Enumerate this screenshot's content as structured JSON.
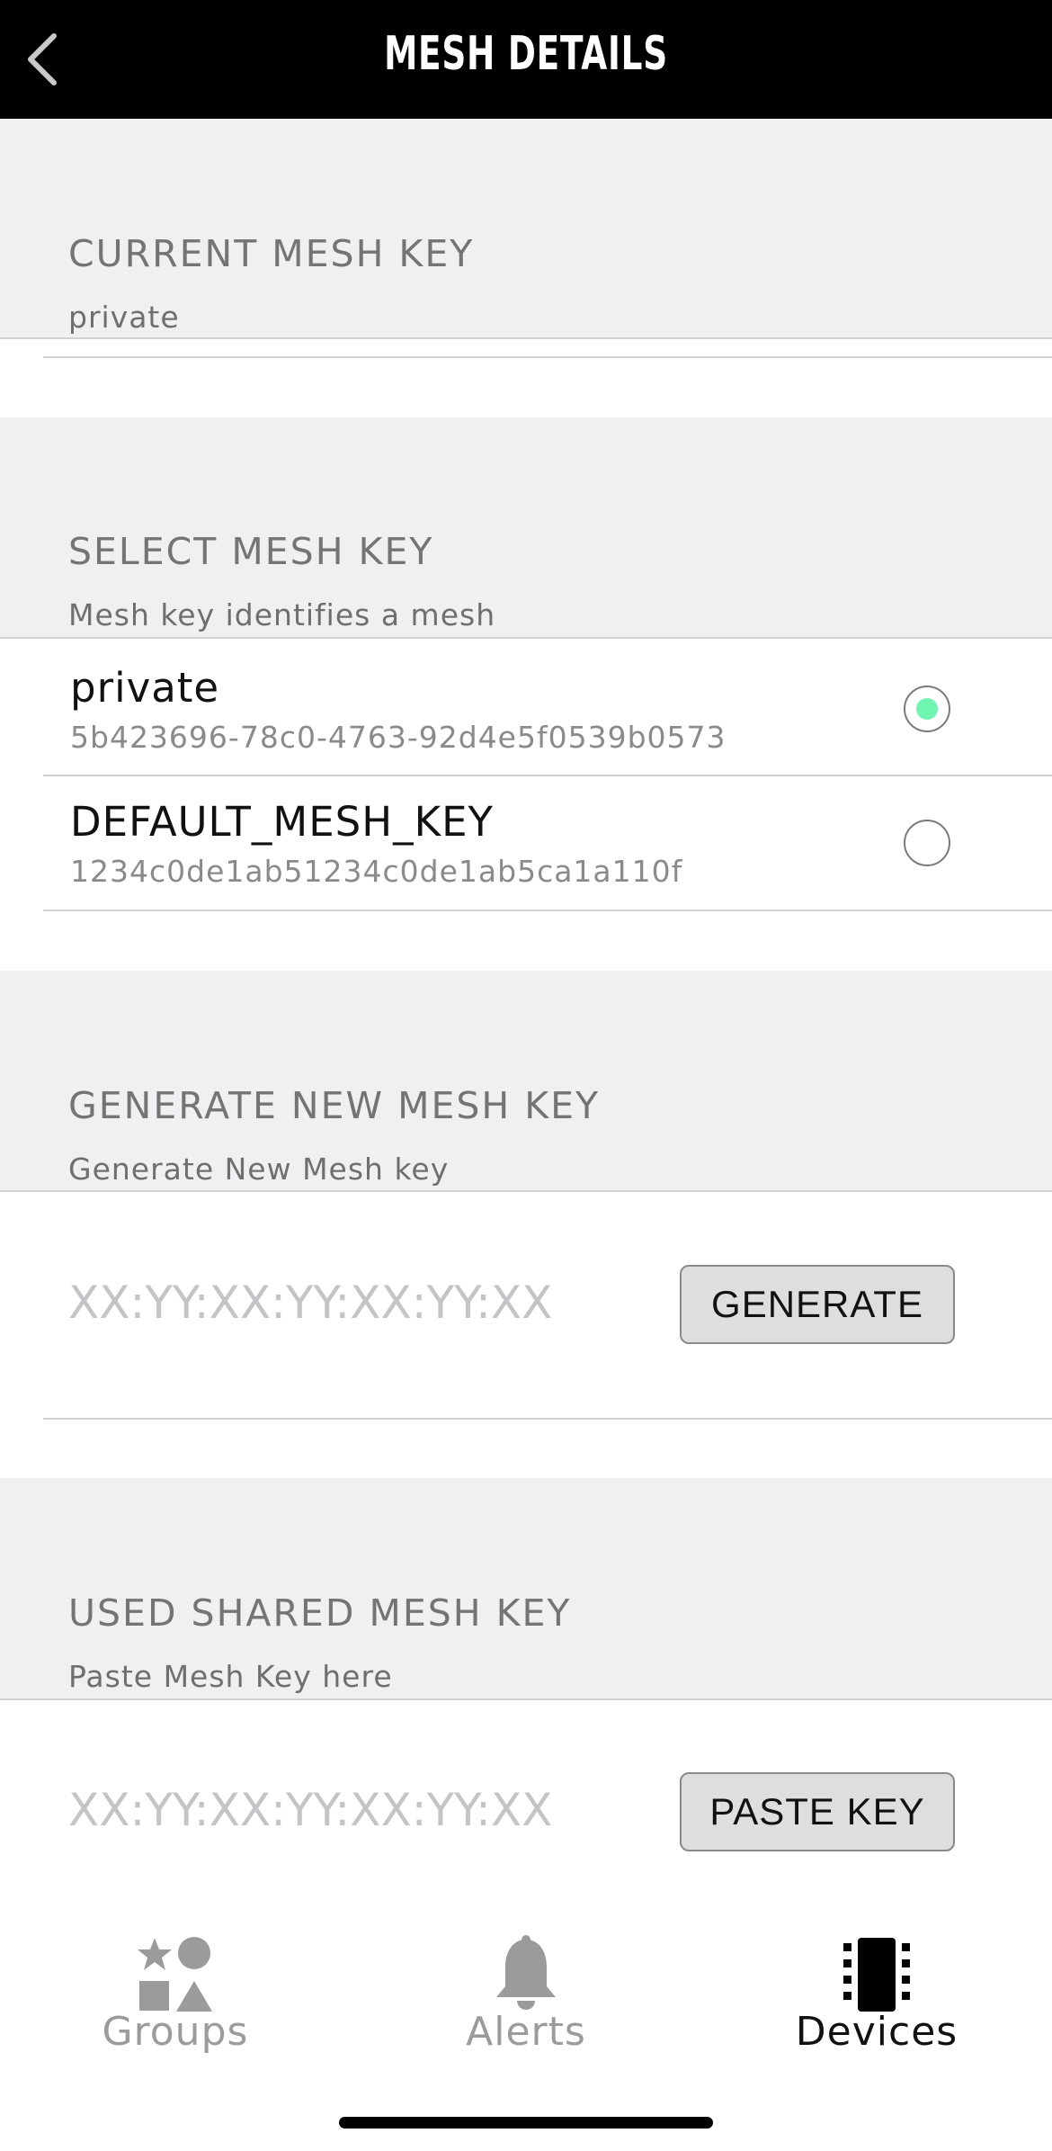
{
  "header": {
    "title": "MESH DETAILS",
    "back_icon": "chevron-left-icon"
  },
  "current_key": {
    "title": "CURRENT MESH KEY",
    "value": "private"
  },
  "select_key": {
    "title": "SELECT MESH KEY",
    "subtitle": "Mesh key identifies a mesh",
    "options": [
      {
        "name": "private",
        "value": "5b423696-78c0-4763-92d4e5f0539b0573",
        "selected": true
      },
      {
        "name": "DEFAULT_MESH_KEY",
        "value": "1234c0de1ab51234c0de1ab5ca1a110f",
        "selected": false
      }
    ]
  },
  "generate_key": {
    "title": "GENERATE NEW MESH KEY",
    "subtitle": "Generate New Mesh key",
    "placeholder": "XX:YY:XX:YY:XX:YY:XX",
    "button_label": "GENERATE"
  },
  "shared_key": {
    "title": "USED SHARED MESH KEY",
    "subtitle": "Paste Mesh Key here",
    "placeholder": "XX:YY:XX:YY:XX:YY:XX",
    "button_label": "PASTE KEY"
  },
  "tabbar": {
    "tabs": [
      {
        "label": "Groups",
        "icon": "shapes-icon",
        "active": false
      },
      {
        "label": "Alerts",
        "icon": "bell-icon",
        "active": false
      },
      {
        "label": "Devices",
        "icon": "chip-icon",
        "active": true
      }
    ]
  },
  "colors": {
    "header_bg": "#000000",
    "section_bg": "#f0f0f2",
    "radio_selected": "#6ff5b0",
    "button_bg": "#dedede"
  }
}
